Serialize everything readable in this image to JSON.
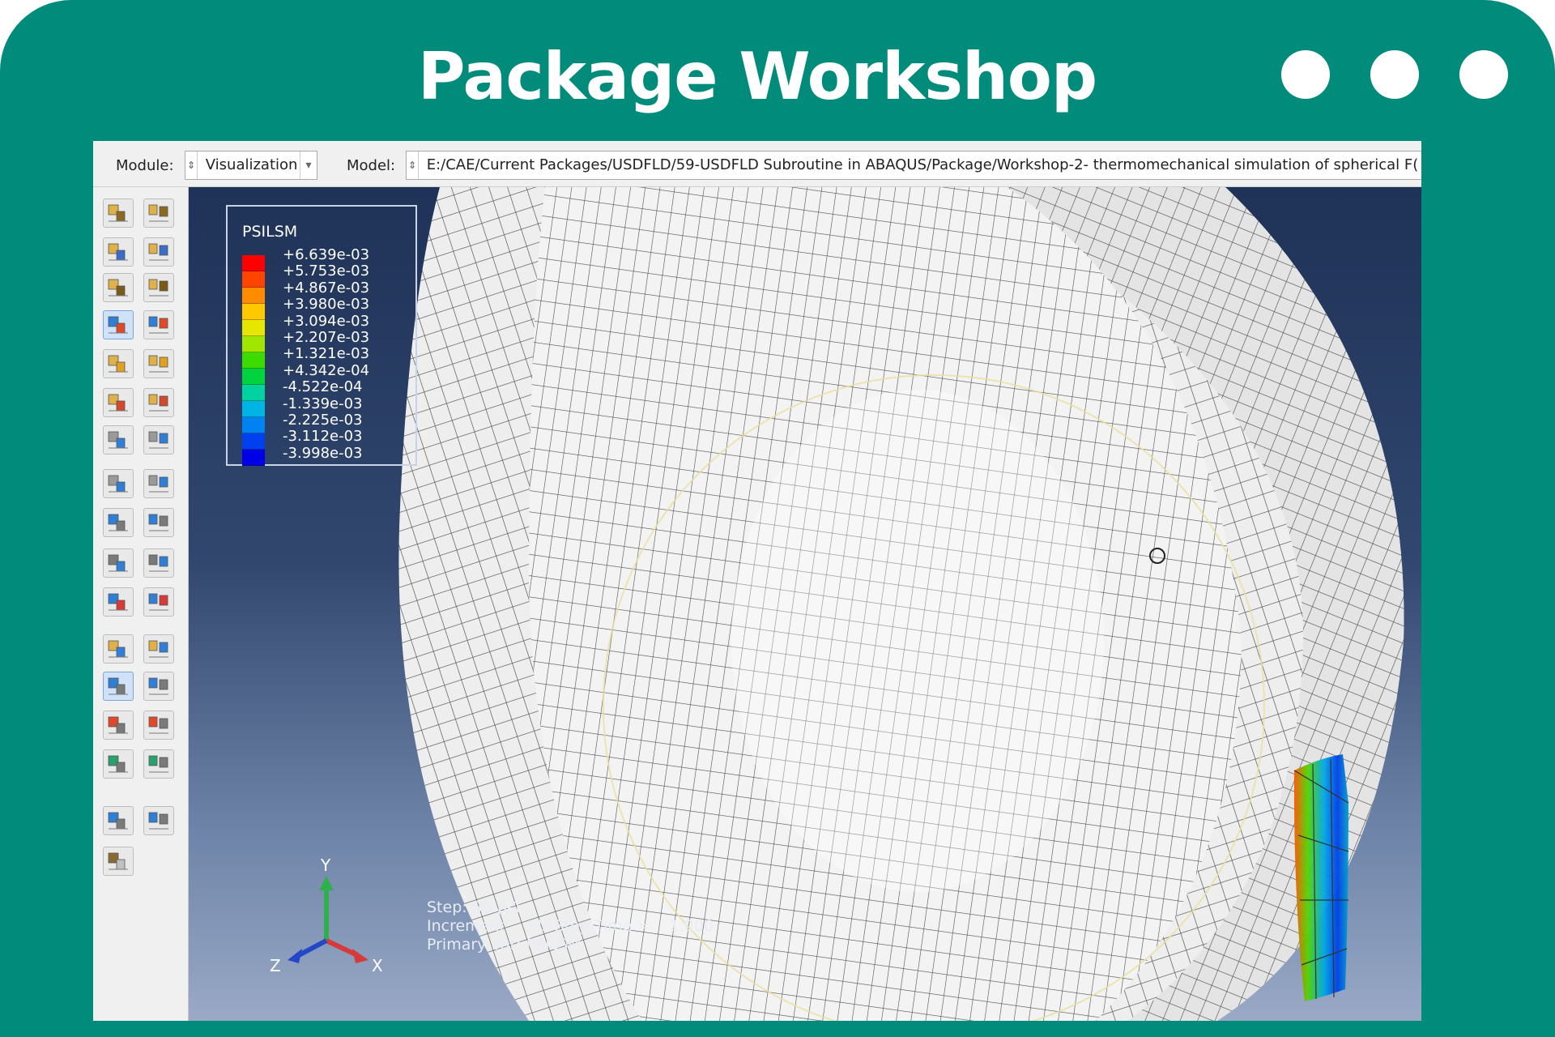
{
  "window": {
    "title": "Package Workshop"
  },
  "toolbar": {
    "module_label": "Module:",
    "module_value": "Visualization",
    "model_label": "Model:",
    "model_value": "E:/CAE/Current Packages/USDFLD/59-USDFLD Subroutine in ABAQUS/Package/Workshop-2- thermomechanical simulation of spherical F("
  },
  "legend": {
    "title": "PSILSM",
    "values": [
      "+6.639e-03",
      "+5.753e-03",
      "+4.867e-03",
      "+3.980e-03",
      "+3.094e-03",
      "+2.207e-03",
      "+1.321e-03",
      "+4.342e-04",
      "-4.522e-04",
      "-1.339e-03",
      "-2.225e-03",
      "-3.112e-03",
      "-3.998e-03"
    ],
    "colors": [
      "#ff0000",
      "#ff4400",
      "#ff8c00",
      "#ffc800",
      "#e6e600",
      "#a0e600",
      "#3cdc00",
      "#00d240",
      "#00d2a0",
      "#00b4e6",
      "#0082f0",
      "#0040f0",
      "#0000e6"
    ]
  },
  "triad": {
    "y": "Y",
    "x": "X",
    "z": "Z"
  },
  "step_info": {
    "line1": "Step: Step-1",
    "line2": "Increment      1: Step Time =    1.000",
    "line3": "Primary Var: PSILSM"
  },
  "colors": {
    "frame": "#008b7a",
    "viewport_top": "#1f3258",
    "viewport_bottom": "#9aa9c6",
    "mesh_face": "#ececec"
  },
  "icons": [
    "layers-icon",
    "plot-deformed-icon",
    "contour-icon",
    "symbol-icon",
    "material-orientation-icon",
    "animate-icon",
    "coordinate-triad-icon",
    "xy-data-icon",
    "path-icon",
    "display-group-icon",
    "result-options-icon",
    "cut-view-icon",
    "replace-icon",
    "query-icon"
  ]
}
